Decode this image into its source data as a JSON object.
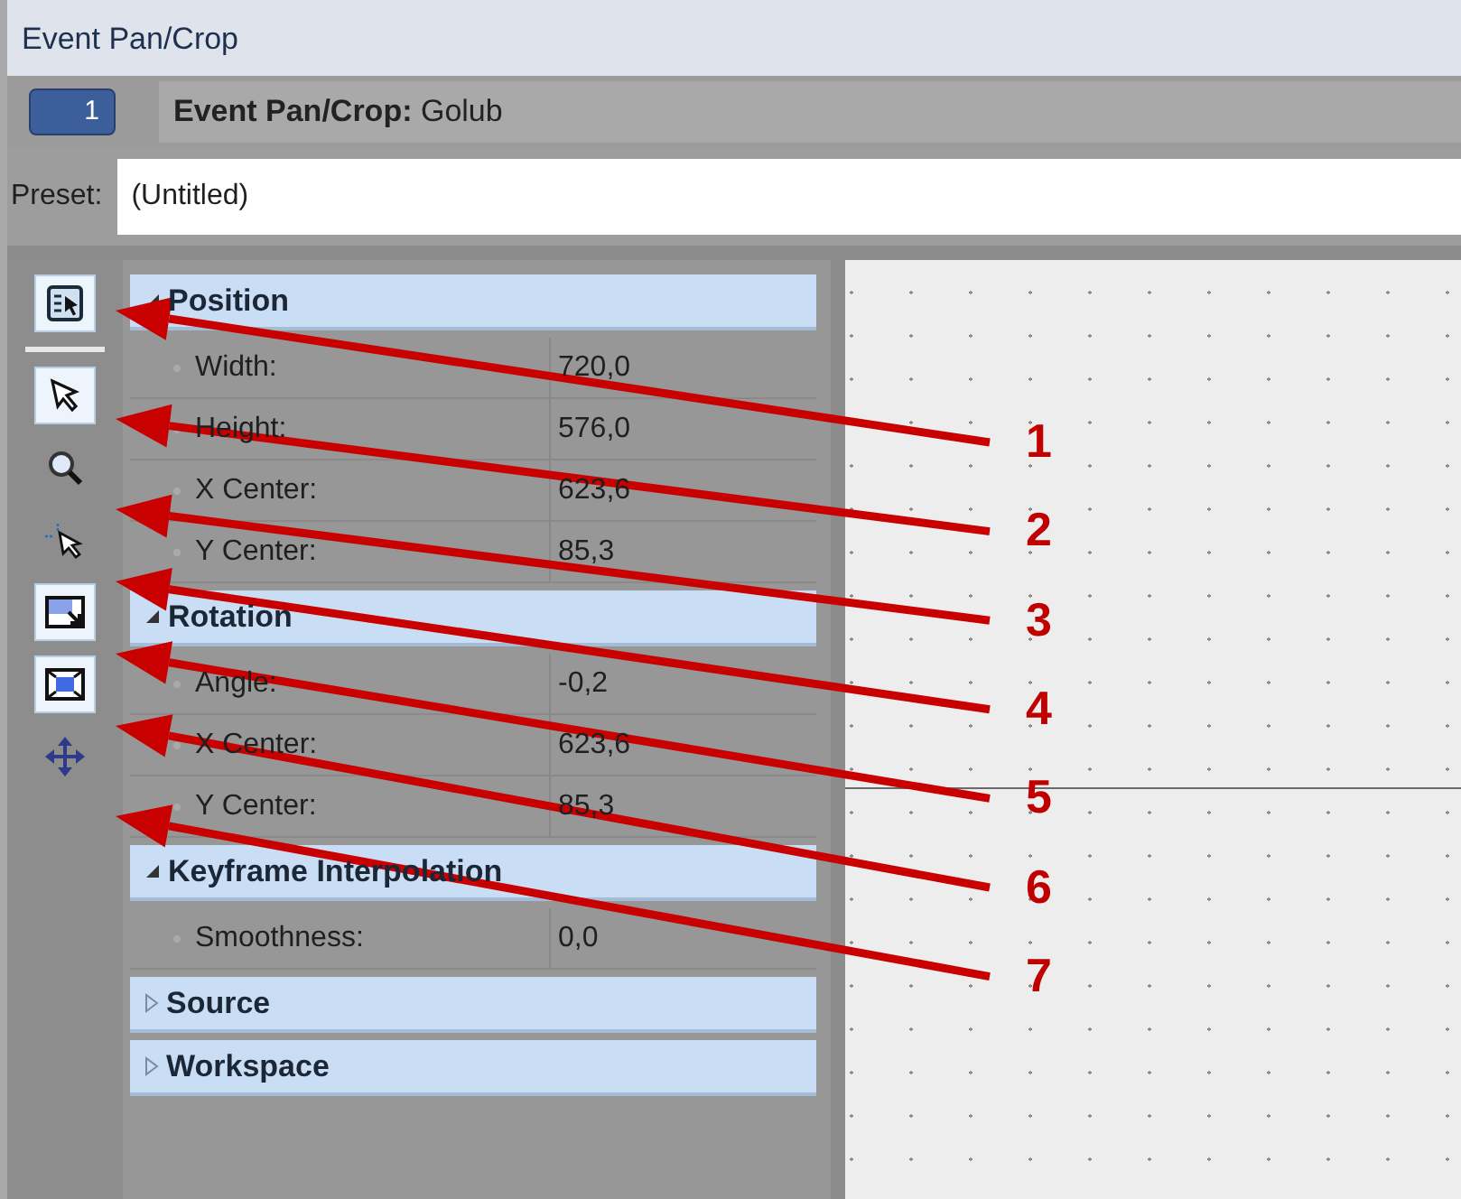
{
  "window": {
    "title": "Event Pan/Crop"
  },
  "header": {
    "number": "1",
    "title": "**Event Pan/Crop:** Golub"
  },
  "preset": {
    "label": "Preset:",
    "value": "(Untitled)"
  },
  "tools": [
    {
      "kind": "panel",
      "on": true
    },
    {
      "kind": "pointer",
      "on": true
    },
    {
      "kind": "zoom",
      "on": false
    },
    {
      "kind": "crosshair",
      "on": false
    },
    {
      "kind": "resize",
      "on": true
    },
    {
      "kind": "frame",
      "on": true
    },
    {
      "kind": "move",
      "on": false
    }
  ],
  "groups": [
    {
      "title": "Position",
      "expanded": true,
      "rows": [
        {
          "label": "Width:",
          "value": "720,0"
        },
        {
          "label": "Height:",
          "value": "576,0"
        },
        {
          "label": "X Center:",
          "value": "623,6"
        },
        {
          "label": "Y Center:",
          "value": "85,3"
        }
      ]
    },
    {
      "title": "Rotation",
      "expanded": true,
      "rows": [
        {
          "label": "Angle:",
          "value": "-0,2"
        },
        {
          "label": "X Center:",
          "value": "623,6"
        },
        {
          "label": "Y Center:",
          "value": "85,3"
        }
      ]
    },
    {
      "title": "Keyframe Interpolation",
      "expanded": true,
      "rows": [
        {
          "label": "Smoothness:",
          "value": "0,0"
        }
      ]
    },
    {
      "title": "Source",
      "expanded": false
    },
    {
      "title": "Workspace",
      "expanded": false
    }
  ],
  "annotations": [
    {
      "label": "1"
    },
    {
      "label": "2"
    },
    {
      "label": "3"
    },
    {
      "label": "4"
    },
    {
      "label": "5"
    },
    {
      "label": "6"
    },
    {
      "label": "7"
    }
  ]
}
